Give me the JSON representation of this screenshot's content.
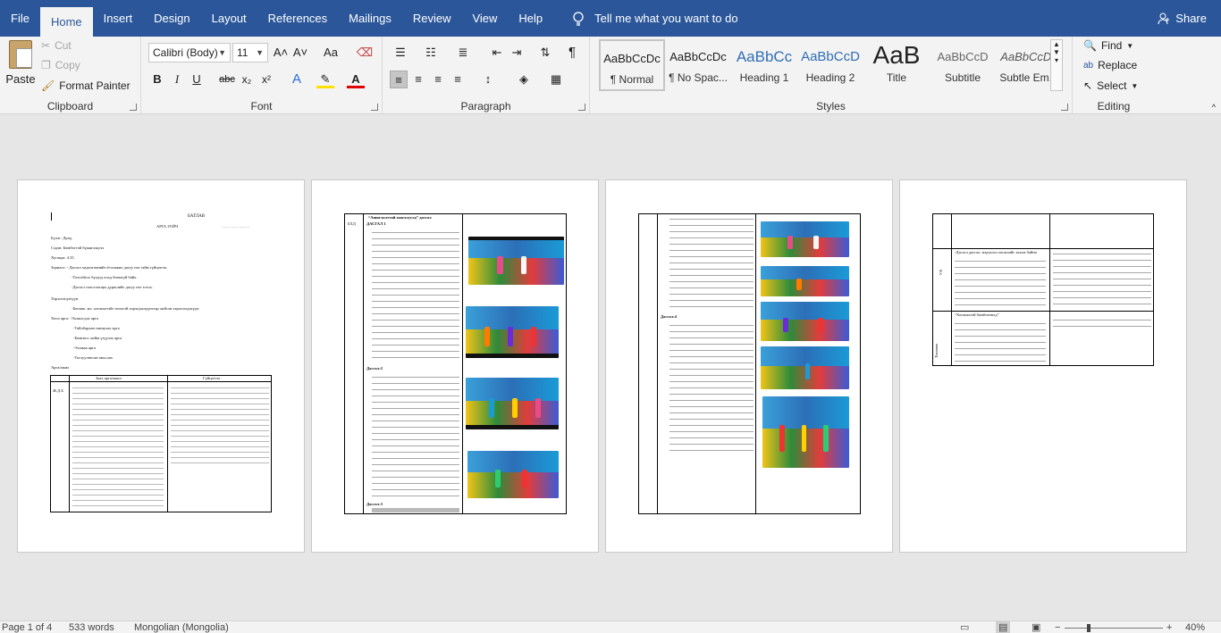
{
  "tabs": [
    "File",
    "Home",
    "Insert",
    "Design",
    "Layout",
    "References",
    "Mailings",
    "Review",
    "View",
    "Help"
  ],
  "tell_me": "Tell me what you want to do",
  "share": "Share",
  "clipboard": {
    "paste": "Paste",
    "cut": "Cut",
    "copy": "Copy",
    "format_painter": "Format Painter",
    "label": "Clipboard"
  },
  "font": {
    "name": "Calibri (Body)",
    "size": "11",
    "label": "Font",
    "grow": "A˄",
    "shrink": "A˅",
    "case": "Aa",
    "bold": "B",
    "italic": "I",
    "underline": "U",
    "strike": "abc",
    "sub": "x₂",
    "sup": "x²"
  },
  "paragraph": {
    "label": "Paragraph",
    "pilcrow": "¶"
  },
  "styles": {
    "label": "Styles",
    "items": [
      {
        "preview": "AaBbCcDc",
        "name": "¶ Normal"
      },
      {
        "preview": "AaBbCcDc",
        "name": "¶ No Spac..."
      },
      {
        "preview": "AaBbCc",
        "name": "Heading 1"
      },
      {
        "preview": "AaBbCcD",
        "name": "Heading 2"
      },
      {
        "preview": "AaB",
        "name": "Title"
      },
      {
        "preview": "AaBbCcD",
        "name": "Subtitle"
      },
      {
        "preview": "AaBbCcDc",
        "name": "Subtle Em..."
      }
    ]
  },
  "editing": {
    "find": "Find",
    "replace": "Replace",
    "select": "Select",
    "label": "Editing"
  },
  "page1": {
    "title": "БАТЛАВ",
    "subtitle": "АРГА ЗҮЙЧ",
    "lines": [
      "Бүлэг: Дунд",
      "Сэдэв: Бөмбөгтэй бүжиглэцгээ",
      "Хугацаа: 4.35",
      "Зорилго: - Дасгал хөдөлгөөнийг ёгчлэжил дагуу нэг зэйм гүйцэтгэх.",
      "-Толгойгоо бүгдод оохд бөөмгүй байх.",
      "-Дасгал топосоопцы дуршлийг дагуу нэг тогох.",
      "Хэрэглэгдэхүүн",
      "-Бөгмөк .мо .хөгжилтэйг нээлтэй хэрэгдэхэүүнгээр хийсэн хэрэглэгдэхүүн",
      "Хөсө арга: -Ээлжлсдэх арга",
      "-Тайлбарлан таниулах арга",
      "-Бөмгиос хийж үзүүлэх арга",
      "-Ээлжаа арга",
      "-Тоглуулнесан амьслах",
      "Арга/ажил"
    ],
    "table_head": [
      "Заах арга/ажил",
      "Гүйцэтгэх"
    ],
    "table_side": "Ж.Д.Б"
  },
  "page2": {
    "side": "БХД",
    "heading": "“Ашиглалттай ажиллуулд” дасгал",
    "steps": [
      "ДАСГАЛ 1",
      "Дасгал:2",
      "Дасгал:3"
    ]
  },
  "page3": {
    "step": "Дасгал:4"
  },
  "page4": {
    "side1": "УХ",
    "side2": "Тоглоом",
    "cell1": "-Дасгал дасгал: мэдээлэл хөгжлийг эхэлж байна",
    "cell2": "“Хөгжилтэй бөмбөгнөлд”"
  },
  "status": {
    "page": "Page 1 of 4",
    "words": "533 words",
    "language": "Mongolian (Mongolia)",
    "zoom": "40%"
  }
}
